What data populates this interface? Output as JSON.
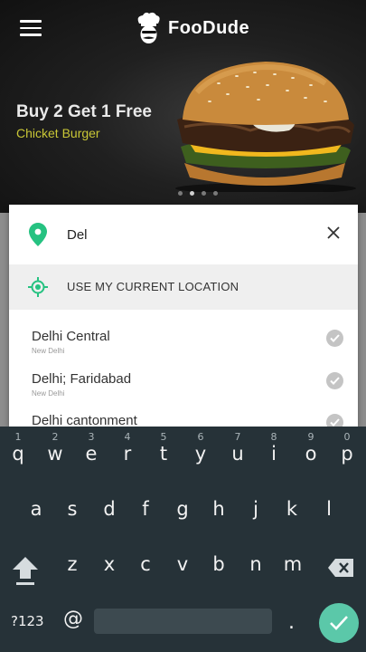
{
  "app": {
    "name": "FooDude",
    "accent_color": "#26c281"
  },
  "banner": {
    "promo_title": "Buy 2 Get 1 Free",
    "promo_subtitle": "Chicket Burger",
    "slides": 4,
    "active_slide": 2
  },
  "search": {
    "value": "Del",
    "placeholder": "",
    "current_location_label": "USE MY CURRENT LOCATION"
  },
  "results": [
    {
      "title": "Delhi Central",
      "subtitle": "New Delhi"
    },
    {
      "title": "Delhi; Faridabad",
      "subtitle": "New Delhi"
    },
    {
      "title": "Delhi cantonment",
      "subtitle": ""
    }
  ],
  "keyboard": {
    "row1": [
      {
        "key": "q",
        "hint": "1"
      },
      {
        "key": "w",
        "hint": "2"
      },
      {
        "key": "e",
        "hint": "3"
      },
      {
        "key": "r",
        "hint": "4"
      },
      {
        "key": "t",
        "hint": "5"
      },
      {
        "key": "y",
        "hint": "6"
      },
      {
        "key": "u",
        "hint": "7"
      },
      {
        "key": "i",
        "hint": "8"
      },
      {
        "key": "o",
        "hint": "9"
      },
      {
        "key": "p",
        "hint": "0"
      }
    ],
    "row2": [
      "a",
      "s",
      "d",
      "f",
      "g",
      "h",
      "j",
      "k",
      "l"
    ],
    "row3": [
      "z",
      "x",
      "c",
      "v",
      "b",
      "n",
      "m"
    ],
    "symbols_label": "?123",
    "at_label": "@",
    "period_label": "."
  }
}
